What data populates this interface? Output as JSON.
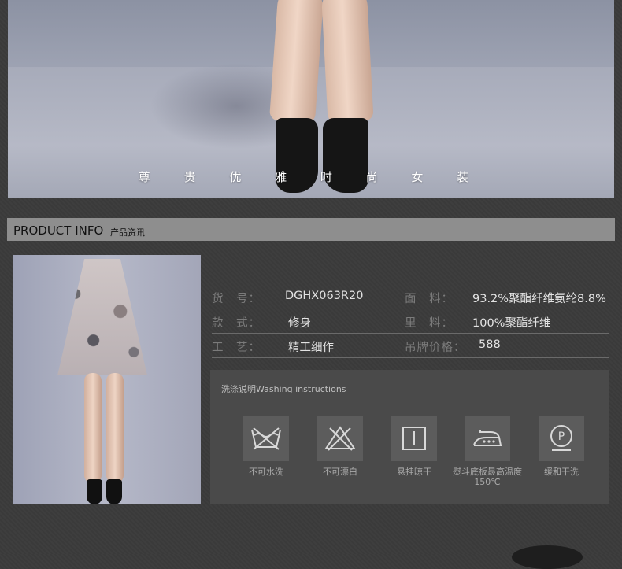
{
  "hero": {
    "caption": "尊 贵 优 雅 时 尚 女 装"
  },
  "section": {
    "title_en": "PRODUCT INFO",
    "title_zh": "产品资讯"
  },
  "product_info": {
    "rows": [
      {
        "left_label": "货　号：",
        "left_value": "DGHX063R20",
        "right_label": "面　料：",
        "right_value": "93.2%聚酯纤维氨纶8.8%"
      },
      {
        "left_label": "款　式：",
        "left_value": "修身",
        "right_label": "里　料：",
        "right_value": "100%聚酯纤维"
      },
      {
        "left_label": "工　艺：",
        "left_value": "精工细作",
        "right_label": "吊牌价格：",
        "right_value": "588"
      }
    ]
  },
  "washing": {
    "title": "洗涤说明Washing instructions",
    "items": [
      {
        "icon": "no-machine-wash-icon",
        "label": "不可水洗"
      },
      {
        "icon": "no-bleach-icon",
        "label": "不可漂白"
      },
      {
        "icon": "hang-dry-icon",
        "label": "悬挂晾干"
      },
      {
        "icon": "iron-150-icon",
        "label": "熨斗底板最高温度150℃"
      },
      {
        "icon": "gentle-dry-clean-icon",
        "label": "缓和干洗"
      }
    ]
  }
}
